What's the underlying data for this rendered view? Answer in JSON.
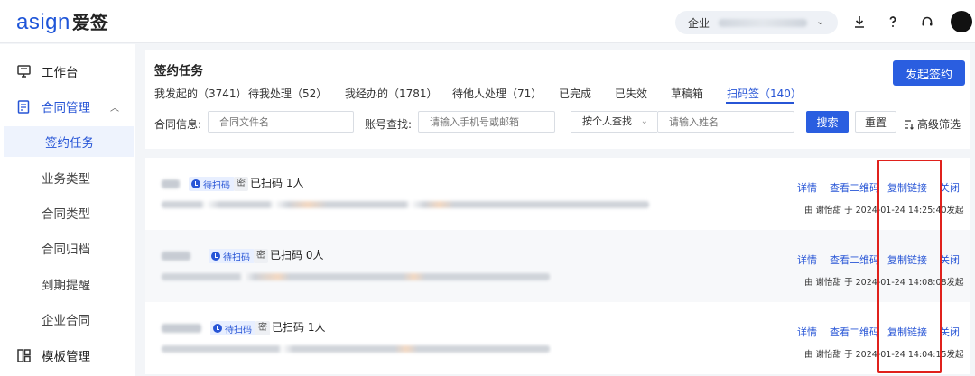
{
  "brand": {
    "logo_latin": "asign",
    "logo_cn": "爱签"
  },
  "topbar": {
    "company_label": "企业"
  },
  "sidebar": {
    "items": [
      {
        "label": "工作台",
        "icon": "monitor-icon"
      },
      {
        "label": "合同管理",
        "icon": "document-icon"
      },
      {
        "label": "签约任务"
      },
      {
        "label": "业务类型"
      },
      {
        "label": "合同类型"
      },
      {
        "label": "合同归档"
      },
      {
        "label": "到期提醒"
      },
      {
        "label": "企业合同"
      },
      {
        "label": "模板管理",
        "icon": "template-icon"
      }
    ]
  },
  "page": {
    "title": "签约任务",
    "launch_label": "发起签约"
  },
  "tabs": [
    {
      "label": "我发起的（3741）"
    },
    {
      "label": "待我处理（52）"
    },
    {
      "label": "我经办的（1781）"
    },
    {
      "label": "待他人处理（71）"
    },
    {
      "label": "已完成"
    },
    {
      "label": "已失效"
    },
    {
      "label": "草稿箱"
    },
    {
      "label": "扫码签（140）"
    }
  ],
  "filters": {
    "contract_info_label": "合同信息:",
    "contract_placeholder": "合同文件名",
    "account_label": "账号查找:",
    "account_placeholder": "请输入手机号或邮箱",
    "person_select": "按个人查找",
    "name_placeholder": "请输入姓名",
    "search_label": "搜索",
    "reset_label": "重置",
    "advanced_label": "高级筛选"
  },
  "tasks": [
    {
      "status": "待扫码",
      "secret": "密",
      "scan_count": "已扫码 1人",
      "by_prefix": "由",
      "initiator": "谢怡甜",
      "at": "于",
      "time": "2024-01-24 14:25:40",
      "suffix": "发起"
    },
    {
      "status": "待扫码",
      "secret": "密",
      "scan_count": "已扫码 0人",
      "by_prefix": "由",
      "initiator": "谢怡甜",
      "at": "于",
      "time": "2024-01-24 14:08:08",
      "suffix": "发起"
    },
    {
      "status": "待扫码",
      "secret": "密",
      "scan_count": "已扫码 1人",
      "by_prefix": "由",
      "initiator": "谢怡甜",
      "at": "于",
      "time": "2024-01-24 14:04:15",
      "suffix": "发起"
    }
  ],
  "row_actions": {
    "details": "详情",
    "qr": "查看二维码",
    "copy_link": "复制链接",
    "close": "关闭"
  },
  "colors": {
    "primary": "#2a5ee0",
    "link": "#2755d6",
    "annotation": "#e0211c"
  }
}
